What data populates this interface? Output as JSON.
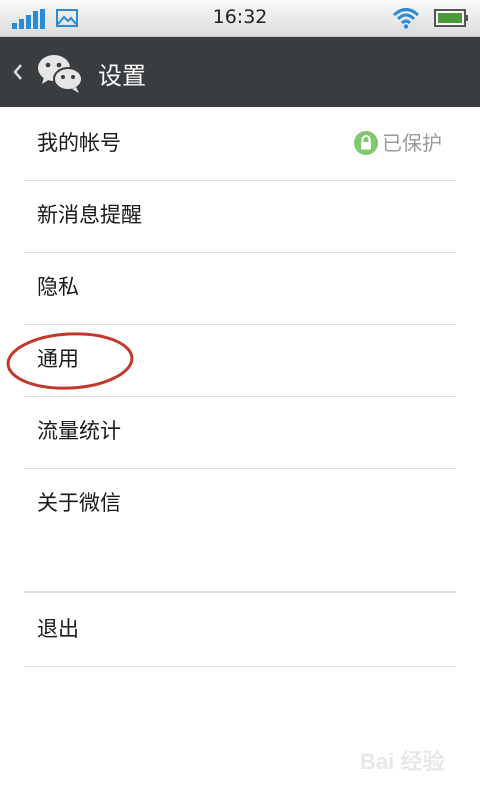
{
  "status_bar": {
    "time": "16:32",
    "icons": [
      "signal-icon",
      "gallery-icon",
      "wifi-icon",
      "battery-icon"
    ],
    "accent_color": "#2a8bd8"
  },
  "title_bar": {
    "title": "设置",
    "background_color": "#3a3d3f",
    "icons": [
      "back-icon",
      "wechat-logo-icon"
    ]
  },
  "menu": {
    "items": [
      {
        "label": "我的帐号",
        "status": "已保护",
        "status_icon": "lock-icon",
        "status_color": "#7fc86b"
      },
      {
        "label": "新消息提醒"
      },
      {
        "label": "隐私"
      },
      {
        "label": "通用",
        "highlighted": true
      },
      {
        "label": "流量统计"
      },
      {
        "label": "关于微信"
      }
    ],
    "logout": {
      "label": "退出"
    }
  },
  "annotation": {
    "highlight_color": "#c0392b"
  },
  "watermark": "Bai 经验"
}
